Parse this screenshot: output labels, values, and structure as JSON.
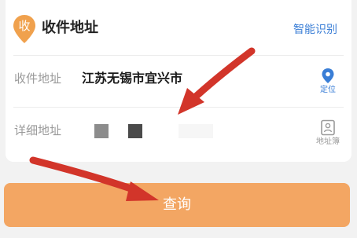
{
  "header": {
    "badge_text": "收",
    "title": "收件地址",
    "smart_recognize_label": "智能识别"
  },
  "form": {
    "receiver_address": {
      "label": "收件地址",
      "value": "江苏无锡市宜兴市",
      "action_label": "定位",
      "action_icon": "location-pin-icon"
    },
    "detail_address": {
      "label": "详细地址",
      "action_label": "地址簿",
      "action_icon": "address-book-icon"
    }
  },
  "query_button": {
    "label": "查询"
  },
  "colors": {
    "accent_orange": "#f3a663",
    "badge_orange": "#f0a14d",
    "link_blue": "#3a7ed6",
    "arrow_red": "#d2352a"
  }
}
